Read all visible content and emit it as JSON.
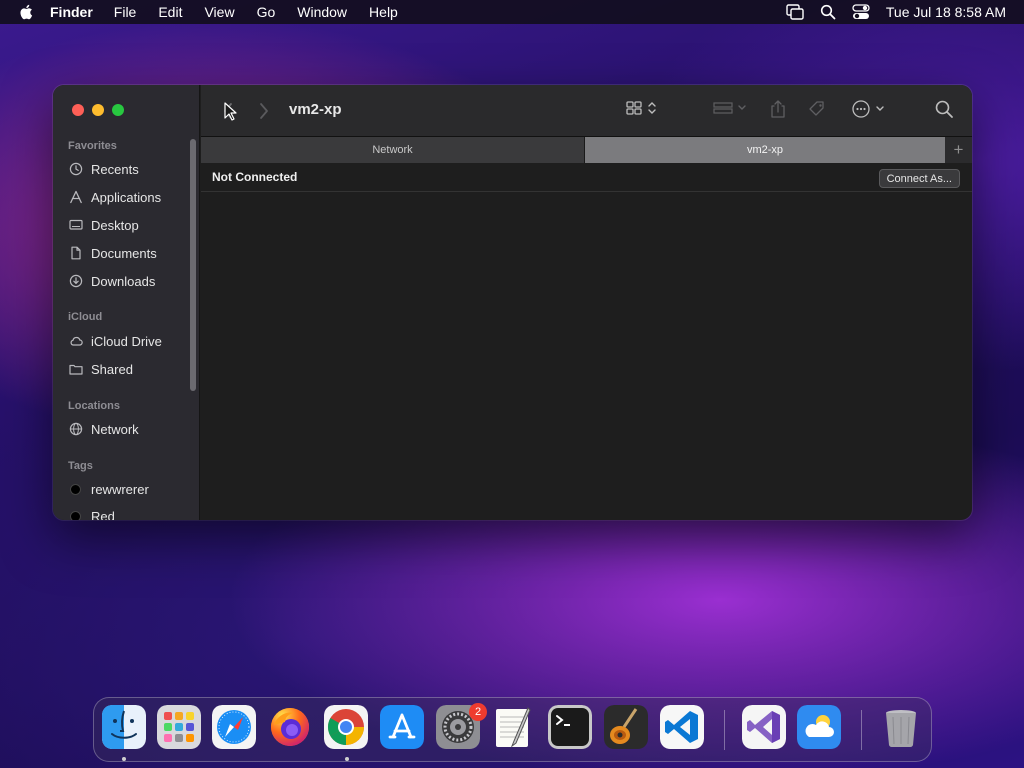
{
  "menubar": {
    "app_name": "Finder",
    "menus": [
      "File",
      "Edit",
      "View",
      "Go",
      "Window",
      "Help"
    ],
    "clock": "Tue Jul 18  8:58 AM",
    "status_icons": [
      "screen-mirroring-icon",
      "spotlight-icon",
      "control-center-icon"
    ]
  },
  "window": {
    "title": "vm2-xp",
    "sidebar": {
      "sections": {
        "favorites": "Favorites",
        "icloud": "iCloud",
        "locations": "Locations",
        "tags": "Tags"
      },
      "favorites": [
        {
          "label": "Recents",
          "icon": "clock-icon"
        },
        {
          "label": "Applications",
          "icon": "applications-icon"
        },
        {
          "label": "Desktop",
          "icon": "desktop-icon"
        },
        {
          "label": "Documents",
          "icon": "document-icon"
        },
        {
          "label": "Downloads",
          "icon": "download-icon"
        }
      ],
      "icloud": [
        {
          "label": "iCloud Drive",
          "icon": "cloud-icon"
        },
        {
          "label": "Shared",
          "icon": "shared-folder-icon"
        }
      ],
      "locations": [
        {
          "label": "Network",
          "icon": "globe-icon"
        }
      ],
      "tags": [
        {
          "label": "rewwrerer",
          "color": "#000000"
        },
        {
          "label": "Red",
          "color": "#000000"
        }
      ]
    },
    "tabs": [
      {
        "label": "Network",
        "active": false
      },
      {
        "label": "vm2-xp",
        "active": true
      }
    ],
    "add_tab": "+",
    "status": "Not Connected",
    "connect_button": "Connect As..."
  },
  "dock": {
    "apps": [
      {
        "name": "Finder",
        "running": true
      },
      {
        "name": "Launchpad",
        "running": false
      },
      {
        "name": "Safari",
        "running": false
      },
      {
        "name": "Firefox",
        "running": false
      },
      {
        "name": "Chrome",
        "running": true
      },
      {
        "name": "App Store",
        "running": false
      },
      {
        "name": "System Settings",
        "running": false,
        "badge": "2"
      },
      {
        "name": "TextEdit",
        "running": false
      },
      {
        "name": "Terminal",
        "running": false
      },
      {
        "name": "GarageBand",
        "running": false
      },
      {
        "name": "Visual Studio Code",
        "running": false
      },
      {
        "name": "Visual Studio",
        "running": false
      },
      {
        "name": "Weather",
        "running": false
      },
      {
        "name": "Trash",
        "running": false
      }
    ]
  }
}
